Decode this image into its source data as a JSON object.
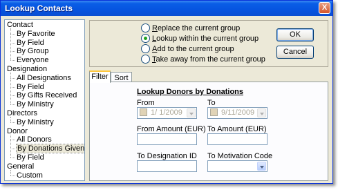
{
  "window": {
    "title": "Lookup Contacts",
    "close_glyph": "X"
  },
  "tree": [
    {
      "label": "Contact",
      "level": 0,
      "name": "tree-item-contact"
    },
    {
      "label": "By Favorite",
      "level": 1,
      "name": "tree-item-contact-by-favorite"
    },
    {
      "label": "By Field",
      "level": 1,
      "name": "tree-item-contact-by-field"
    },
    {
      "label": "By Group",
      "level": 1,
      "name": "tree-item-contact-by-group"
    },
    {
      "label": "Everyone",
      "level": 1,
      "name": "tree-item-contact-everyone"
    },
    {
      "label": "Designation",
      "level": 0,
      "name": "tree-item-designation"
    },
    {
      "label": "All Designations",
      "level": 1,
      "name": "tree-item-all-designations"
    },
    {
      "label": "By Field",
      "level": 1,
      "name": "tree-item-designation-by-field"
    },
    {
      "label": "By Gifts Received",
      "level": 1,
      "name": "tree-item-by-gifts-received"
    },
    {
      "label": "By Ministry",
      "level": 1,
      "name": "tree-item-designation-by-ministry"
    },
    {
      "label": "Directors",
      "level": 0,
      "name": "tree-item-directors"
    },
    {
      "label": "By Ministry",
      "level": 1,
      "name": "tree-item-directors-by-ministry"
    },
    {
      "label": "Donor",
      "level": 0,
      "name": "tree-item-donor"
    },
    {
      "label": "All Donors",
      "level": 1,
      "name": "tree-item-all-donors"
    },
    {
      "label": "By Donations Given",
      "level": 1,
      "name": "tree-item-by-donations-given",
      "selected": true
    },
    {
      "label": "By Field",
      "level": 1,
      "name": "tree-item-donor-by-field"
    },
    {
      "label": "General",
      "level": 0,
      "name": "tree-item-general"
    },
    {
      "label": "Custom",
      "level": 1,
      "name": "tree-item-custom"
    }
  ],
  "options": {
    "replace": {
      "first": "R",
      "rest": "eplace the current group"
    },
    "lookup": {
      "first": "L",
      "rest": "ookup within the current group"
    },
    "add": {
      "first": "A",
      "rest": "dd to the current group"
    },
    "take_away": {
      "first": "T",
      "rest": "ake away from the current group"
    },
    "selected": "lookup"
  },
  "buttons": {
    "ok": "OK",
    "cancel": "Cancel"
  },
  "tabs": {
    "filter": "Filter",
    "sort": "Sort",
    "active": "filter"
  },
  "filter": {
    "title": "Lookup Donors by Donations",
    "from_label": "From",
    "to_label": "To",
    "from_date": "1/  1/2009",
    "to_date": "9/11/2009",
    "from_amount_label": "From Amount (EUR)",
    "to_amount_label": "To Amount (EUR)",
    "from_amount_value": "",
    "to_amount_value": "",
    "designation_label": "To Designation ID",
    "designation_value": "",
    "motivation_label": "To Motivation Code",
    "motivation_value": ""
  }
}
